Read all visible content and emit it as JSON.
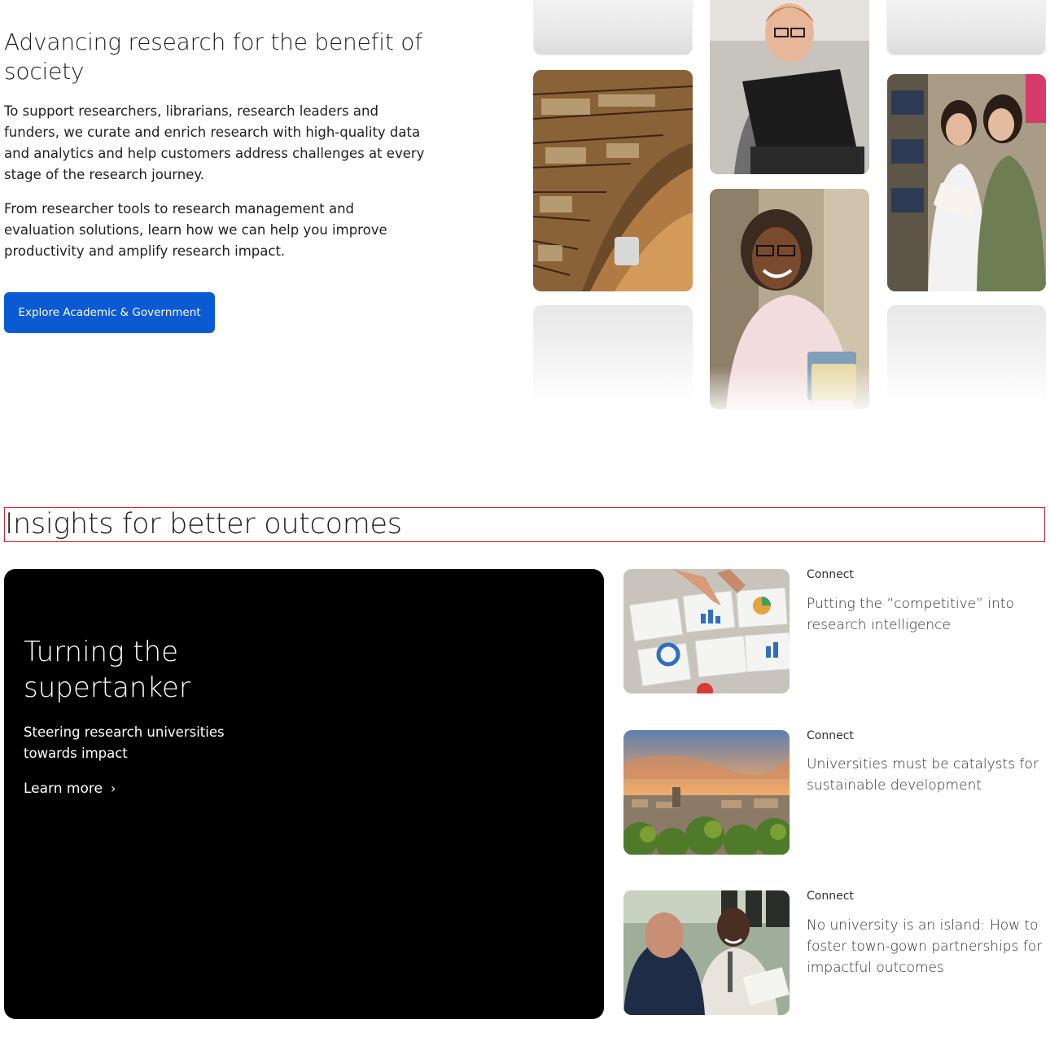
{
  "hero": {
    "title": "Advancing research for the benefit of society",
    "paragraph1": "To support researchers, librarians, research leaders and funders, we curate and enrich research with high-quality data and analytics and help customers address challenges at every stage of the research journey.",
    "paragraph2": "From researcher tools to research management and evaluation solutions, learn how we can help you improve productivity and amplify research impact.",
    "cta_label": "Explore Academic & Government"
  },
  "insights": {
    "title": "Insights for better outcomes",
    "feature": {
      "title": "Turning the supertanker",
      "subtitle": "Steering research universities towards impact",
      "link_label": "Learn more"
    },
    "articles": [
      {
        "tag": "Connect",
        "title": "Putting the “competitive” into research intelligence"
      },
      {
        "tag": "Connect",
        "title": "Universities must be catalysts for sustainable development"
      },
      {
        "tag": "Connect",
        "title": "No university is an island: How to foster town-gown partnerships for impactful outcomes"
      }
    ]
  },
  "colors": {
    "primary_button": "#0a5ad4",
    "feature_background": "#000000",
    "heading_outline": "#d8252f"
  }
}
